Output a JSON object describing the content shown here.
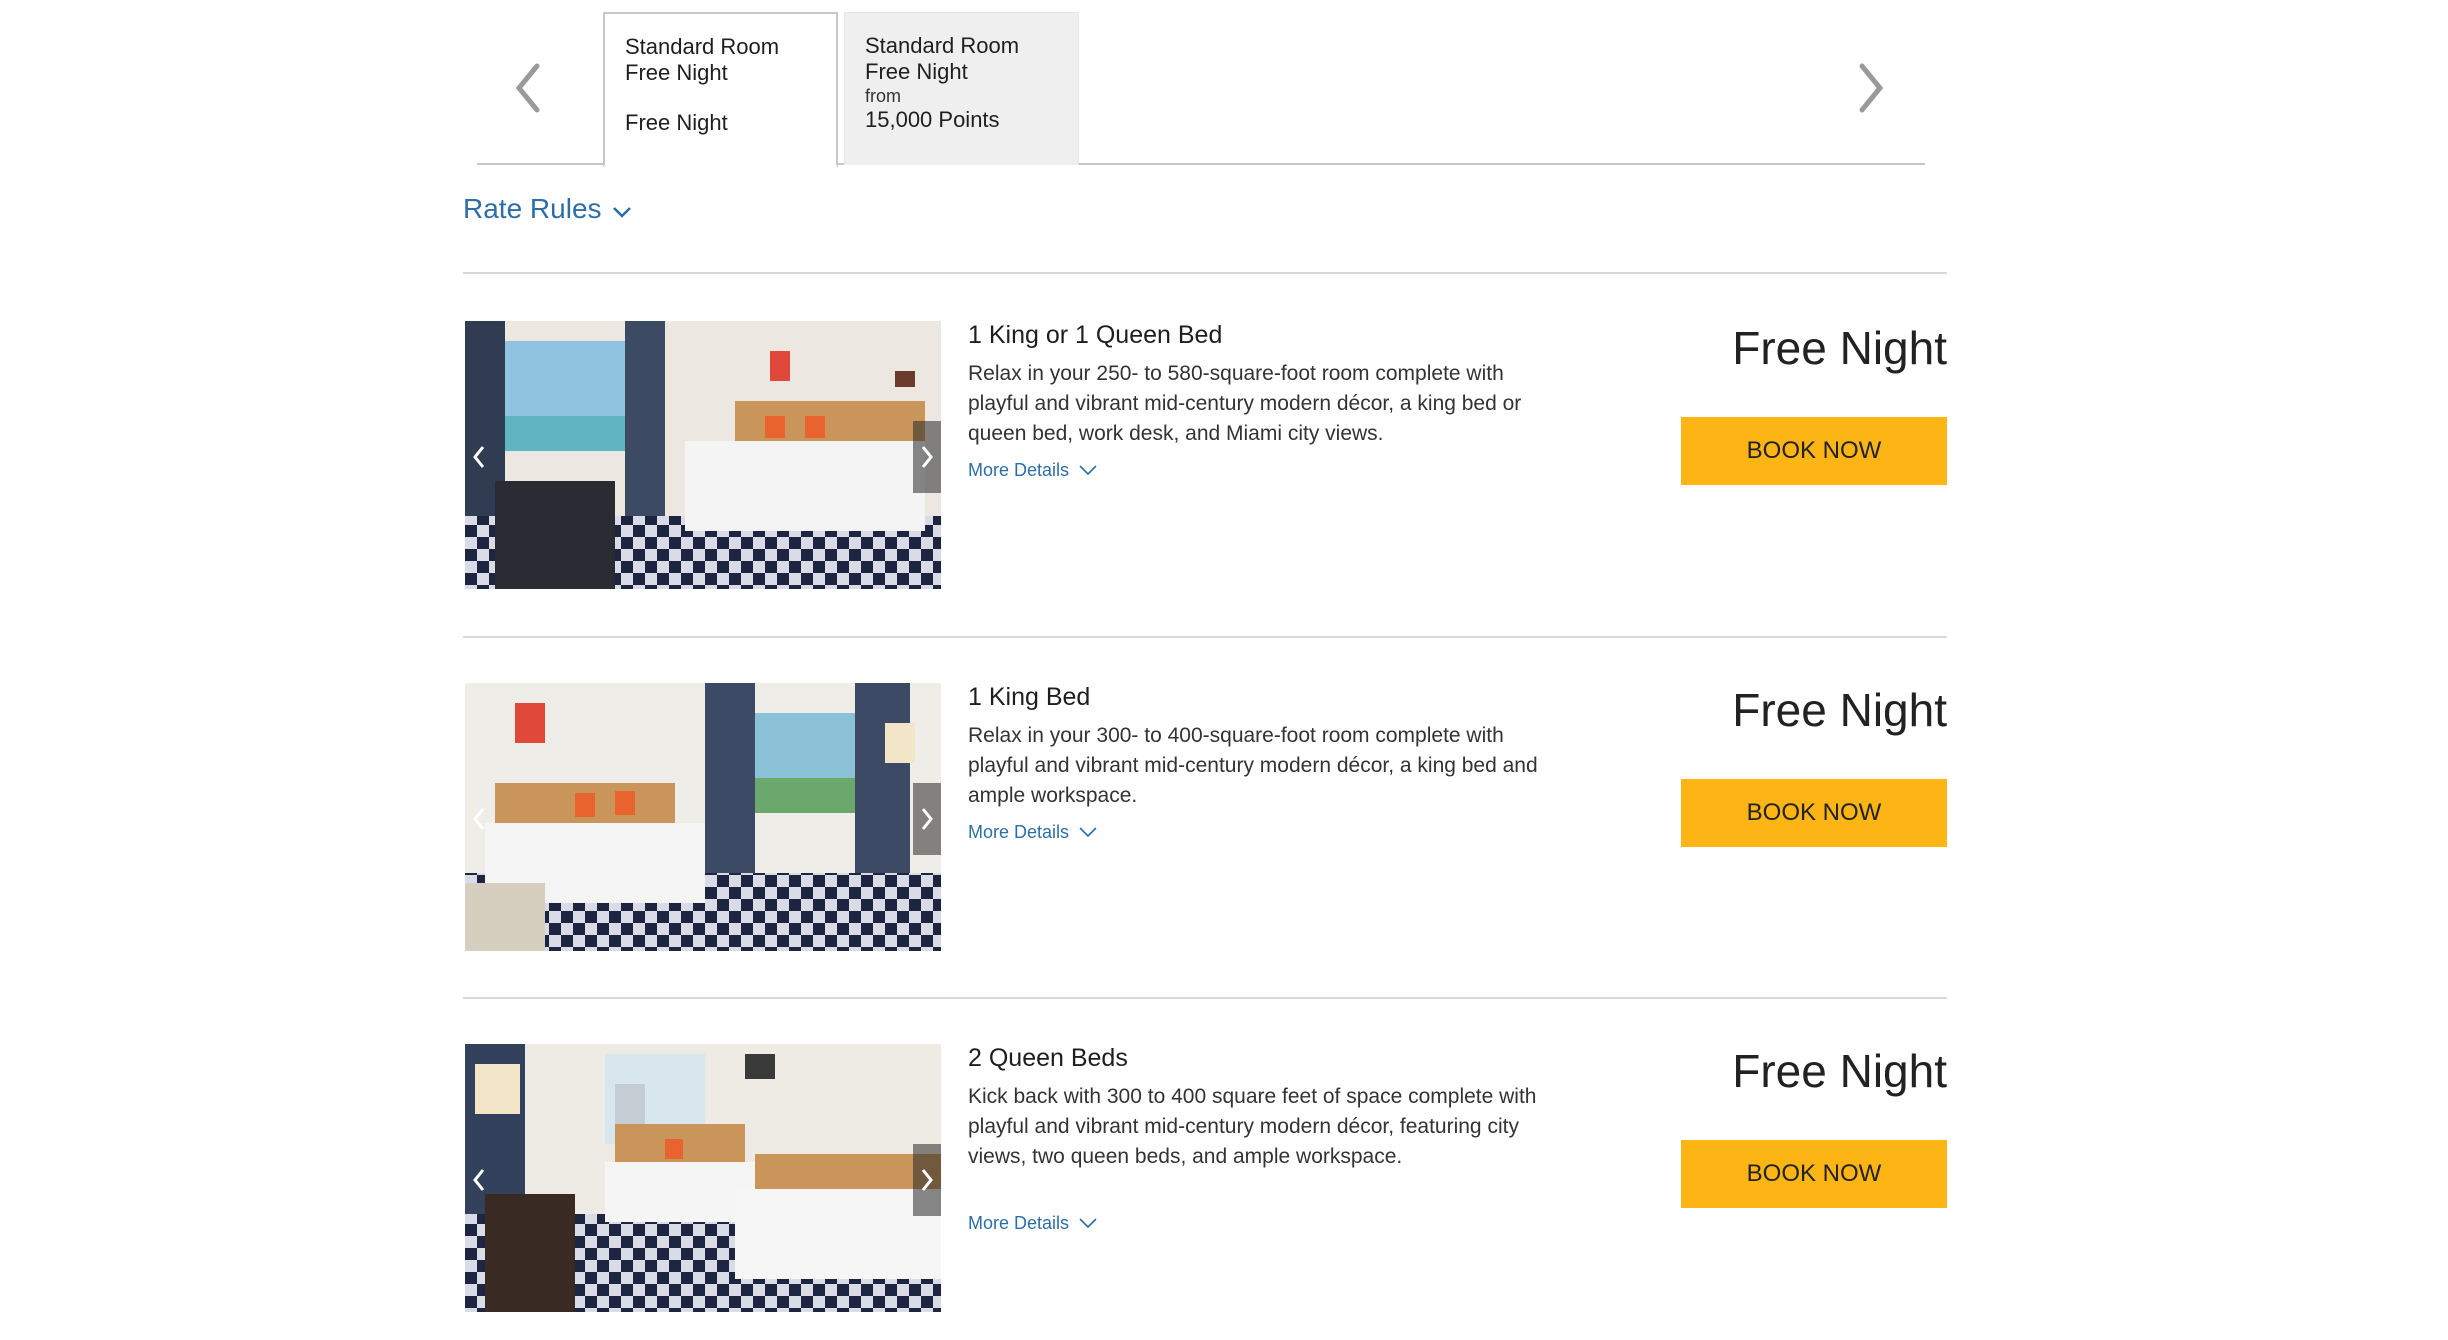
{
  "tabs": [
    {
      "line1": "Standard Room",
      "line2": "Free Night",
      "line3": "",
      "line4": "Free Night"
    },
    {
      "line1": "Standard Room",
      "line2": "Free Night",
      "line3": "from",
      "line4": "15,000 Points"
    }
  ],
  "rate_rules": {
    "label": "Rate Rules"
  },
  "rooms": [
    {
      "title": "1 King or 1 Queen Bed",
      "description": "Relax in your 250- to 580-square-foot room complete with playful and vibrant mid-century modern décor, a king bed or queen bed, work desk, and Miami city views.",
      "more_details": "More Details",
      "price": "Free Night",
      "button": "BOOK NOW"
    },
    {
      "title": "1 King Bed",
      "description": "Relax in your 300- to 400-square-foot room complete with playful and vibrant mid-century modern décor, a king bed and ample workspace.",
      "more_details": "More Details",
      "price": "Free Night",
      "button": "BOOK NOW"
    },
    {
      "title": "2 Queen Beds",
      "description": "Kick back with 300 to 400 square feet of space complete with playful and vibrant mid-century modern décor, featuring city views, two queen beds, and ample workspace.",
      "more_details": "More Details",
      "price": "Free Night",
      "button": "BOOK NOW"
    }
  ],
  "icons": {
    "tab_prev": "chevron-left-icon",
    "tab_next": "chevron-right-icon",
    "expand": "chevron-down-icon"
  },
  "colors": {
    "link": "#2d6ea8",
    "book_button": "#fdb515",
    "inactive_tab": "#efefef"
  }
}
